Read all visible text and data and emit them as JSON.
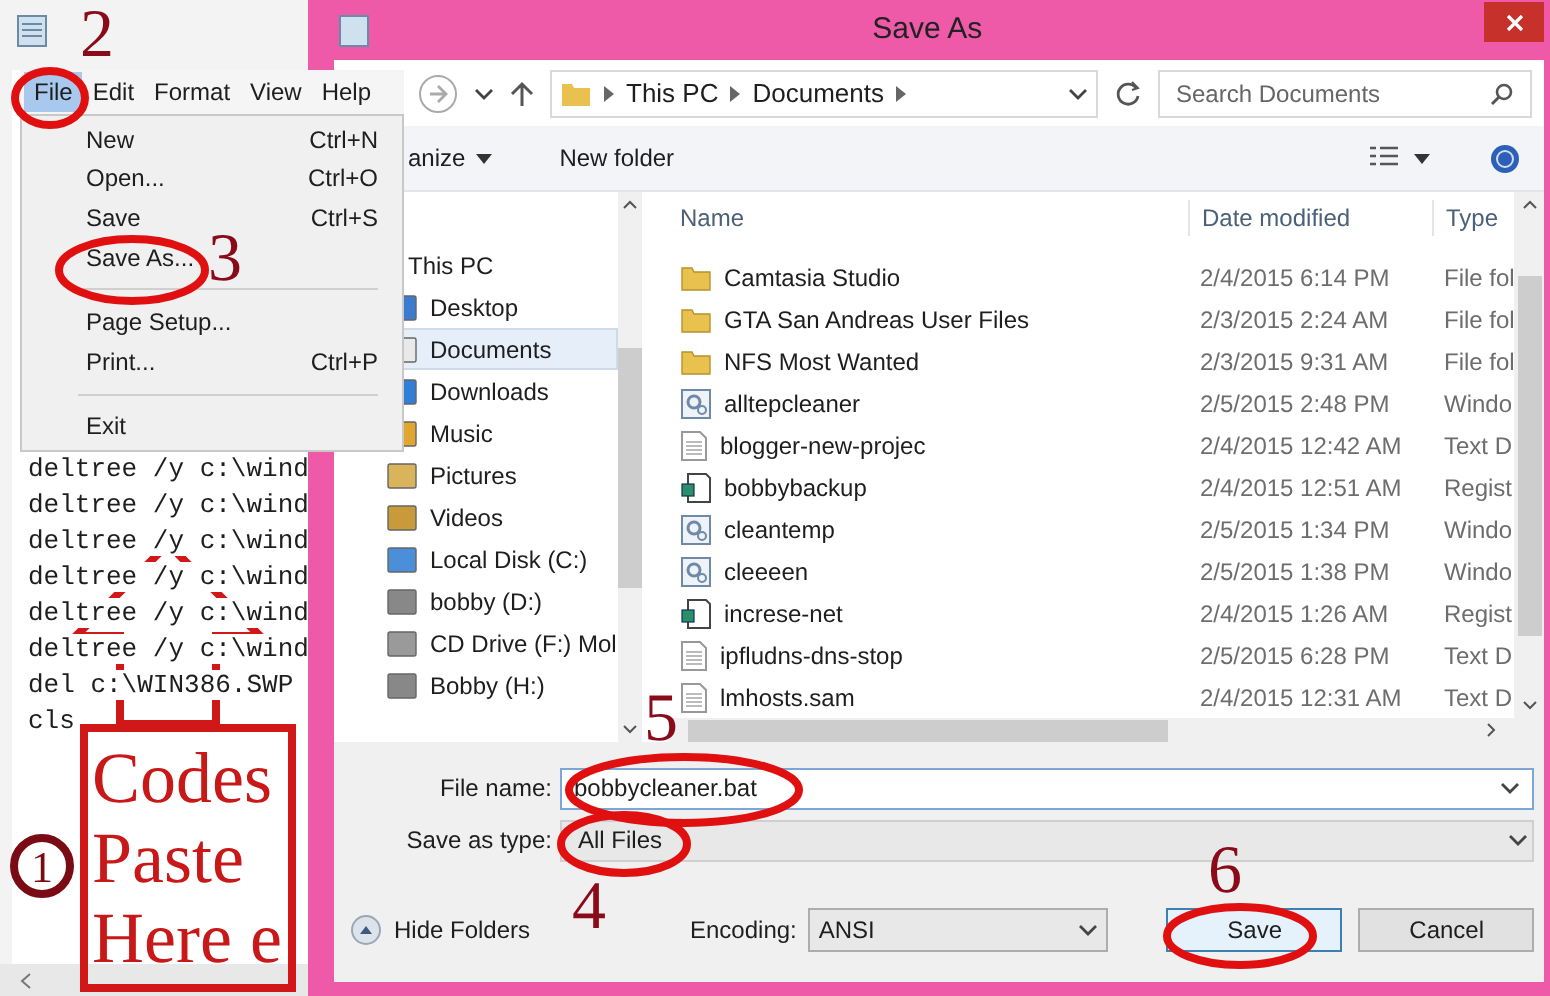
{
  "notepad": {
    "menu_bar": [
      {
        "label": "File",
        "selected": true
      },
      {
        "label": "Edit",
        "selected": false
      },
      {
        "label": "Format",
        "selected": false
      },
      {
        "label": "View",
        "selected": false
      },
      {
        "label": "Help",
        "selected": false
      }
    ],
    "file_menu": [
      {
        "kind": "item",
        "label": "New",
        "shortcut": "Ctrl+N"
      },
      {
        "kind": "item",
        "label": "Open...",
        "shortcut": "Ctrl+O"
      },
      {
        "kind": "item",
        "label": "Save",
        "shortcut": "Ctrl+S"
      },
      {
        "kind": "item",
        "label": "Save As..."
      },
      {
        "kind": "separator"
      },
      {
        "kind": "item",
        "label": "Page Setup..."
      },
      {
        "kind": "item",
        "label": "Print...",
        "shortcut": "Ctrl+P"
      },
      {
        "kind": "separator"
      },
      {
        "kind": "item",
        "label": "Exit"
      }
    ],
    "text_lines": [
      "deltree /y c:\\wind",
      "deltree /y c:\\wind",
      "deltree /y c:\\wind",
      "deltree /y c:\\wind",
      "deltree /y c:\\wind",
      "deltree /y c:\\wind",
      "del c:\\WIN386.SWP",
      "cls"
    ]
  },
  "dialog": {
    "title": "Save As",
    "breadcrumb": [
      "This PC",
      "Documents"
    ],
    "search": {
      "placeholder": "Search Documents"
    },
    "toolbar": {
      "organize": "anize",
      "new_folder": "New folder"
    },
    "nav": {
      "label": "This PC",
      "children": [
        {
          "label": "Desktop",
          "kind": "desktop",
          "selected": false
        },
        {
          "label": "Documents",
          "kind": "document",
          "selected": true
        },
        {
          "label": "Downloads",
          "kind": "download",
          "selected": false
        },
        {
          "label": "Music",
          "kind": "music",
          "selected": false
        },
        {
          "label": "Pictures",
          "kind": "pictures",
          "selected": false
        },
        {
          "label": "Videos",
          "kind": "videos",
          "selected": false
        },
        {
          "label": "Local Disk (C:)",
          "kind": "disk",
          "selected": false
        },
        {
          "label": "bobby (D:)",
          "kind": "drive",
          "selected": false
        },
        {
          "label": "CD Drive (F:) Mol",
          "kind": "cd",
          "selected": false
        },
        {
          "label": "Bobby (H:)",
          "kind": "drive",
          "selected": false
        }
      ]
    },
    "columns": [
      "Name",
      "Date modified",
      "Type"
    ],
    "rows": [
      {
        "kind": "folder",
        "name": "Camtasia Studio",
        "date": "2/4/2015 6:14 PM",
        "type": "File fol"
      },
      {
        "kind": "folder",
        "name": "GTA San Andreas User Files",
        "date": "2/3/2015 2:24 AM",
        "type": "File fol"
      },
      {
        "kind": "folder",
        "name": "NFS Most Wanted",
        "date": "2/3/2015 9:31 AM",
        "type": "File fol"
      },
      {
        "kind": "script",
        "name": "alltepcleaner",
        "date": "2/5/2015 2:48 PM",
        "type": "Windo"
      },
      {
        "kind": "text",
        "name": "blogger-new-projec",
        "date": "2/4/2015 12:42 AM",
        "type": "Text D"
      },
      {
        "kind": "registry",
        "name": "bobbybackup",
        "date": "2/4/2015 12:51 AM",
        "type": "Regist"
      },
      {
        "kind": "script",
        "name": "cleantemp",
        "date": "2/5/2015 1:34 PM",
        "type": "Windo"
      },
      {
        "kind": "script",
        "name": "cleeeen",
        "date": "2/5/2015 1:38 PM",
        "type": "Windo"
      },
      {
        "kind": "registry",
        "name": "increse-net",
        "date": "2/4/2015 1:26 AM",
        "type": "Regist"
      },
      {
        "kind": "text",
        "name": "ipfludns-dns-stop",
        "date": "2/5/2015 6:28 PM",
        "type": "Text D"
      },
      {
        "kind": "text",
        "name": "lmhosts.sam",
        "date": "2/4/2015 12:31 AM",
        "type": "Text D"
      }
    ],
    "file_name_label": "File name:",
    "file_name": "bobbycleaner.bat",
    "save_as_type_label": "Save as type:",
    "save_as_type": "All Files",
    "hide_folders": "Hide Folders",
    "encoding_label": "Encoding:",
    "encoding": "ANSI",
    "buttons": [
      {
        "label": "Save",
        "default": true
      },
      {
        "label": "Cancel",
        "default": false
      }
    ]
  },
  "annotations": {
    "step_numbers": [
      "1",
      "2",
      "3",
      "4",
      "5",
      "6"
    ],
    "note_lines": [
      "Codes",
      "Paste",
      "Here e"
    ]
  }
}
